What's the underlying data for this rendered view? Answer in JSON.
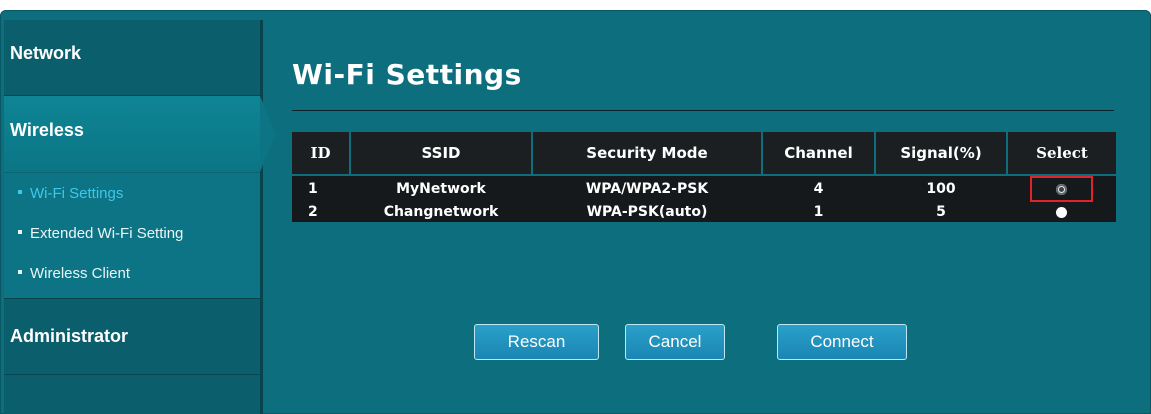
{
  "sidebar": {
    "network_label": "Network",
    "wireless_label": "Wireless",
    "wireless_items": [
      {
        "label": "Wi-Fi Settings",
        "active": true
      },
      {
        "label": "Extended Wi-Fi Setting",
        "active": false
      },
      {
        "label": "Wireless Client",
        "active": false
      }
    ],
    "administrator_label": "Administrator"
  },
  "main": {
    "title": "Wi-Fi Settings",
    "table": {
      "headers": [
        "ID",
        "SSID",
        "Security Mode",
        "Channel",
        "Signal(%)",
        "Select"
      ],
      "rows": [
        {
          "id": "1",
          "ssid": "MyNetwork",
          "security": "WPA/WPA2-PSK",
          "channel": "4",
          "signal": "100",
          "selected": true
        },
        {
          "id": "2",
          "ssid": "Changnetwork",
          "security": "WPA-PSK(auto)",
          "channel": "1",
          "signal": "5",
          "selected": false
        }
      ]
    },
    "buttons": {
      "rescan": "Rescan",
      "cancel": "Cancel",
      "connect": "Connect"
    }
  },
  "colors": {
    "background": "#0d6e7e",
    "sidebar": "#0a5a68",
    "active_link": "#3fc7ea",
    "table_bg": "#15191b",
    "highlight_border": "#e0242a",
    "button": "#1a86b3"
  },
  "icons": {
    "bullet": "square-bullet-icon",
    "radio_checked": "radio-checked-icon",
    "radio_unchecked": "radio-unchecked-icon"
  }
}
